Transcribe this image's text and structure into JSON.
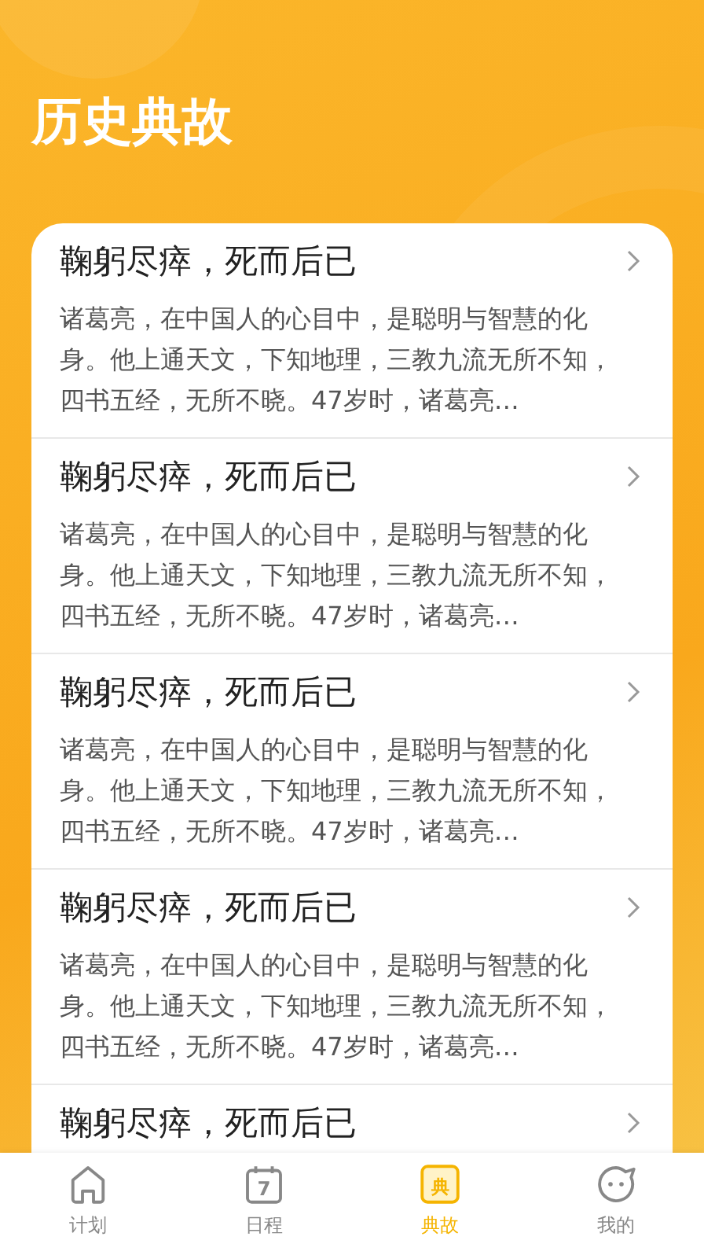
{
  "header": {
    "title": "历史典故"
  },
  "stories": [
    {
      "title": "鞠躬尽瘁，死而后已",
      "summary": "诸葛亮，在中国人的心目中，是聪明与智慧的化身。他上通天文，下知地理，三教九流无所不知，四书五经，无所不晓。47岁时，诸葛亮…"
    },
    {
      "title": "鞠躬尽瘁，死而后已",
      "summary": "诸葛亮，在中国人的心目中，是聪明与智慧的化身。他上通天文，下知地理，三教九流无所不知，四书五经，无所不晓。47岁时，诸葛亮…"
    },
    {
      "title": "鞠躬尽瘁，死而后已",
      "summary": "诸葛亮，在中国人的心目中，是聪明与智慧的化身。他上通天文，下知地理，三教九流无所不知，四书五经，无所不晓。47岁时，诸葛亮…"
    },
    {
      "title": "鞠躬尽瘁，死而后已",
      "summary": "诸葛亮，在中国人的心目中，是聪明与智慧的化身。他上通天文，下知地理，三教九流无所不知，四书五经，无所不晓。47岁时，诸葛亮…"
    },
    {
      "title": "鞠躬尽瘁，死而后已"
    }
  ],
  "tab_bar": [
    {
      "kind": "home",
      "label": "计划",
      "selected": false
    },
    {
      "kind": "calendar",
      "icon_text": "7",
      "label": "日程",
      "selected": false
    },
    {
      "kind": "book",
      "icon_text": "典",
      "label": "典故",
      "selected": true
    },
    {
      "kind": "chat",
      "label": "我的",
      "selected": false
    }
  ]
}
